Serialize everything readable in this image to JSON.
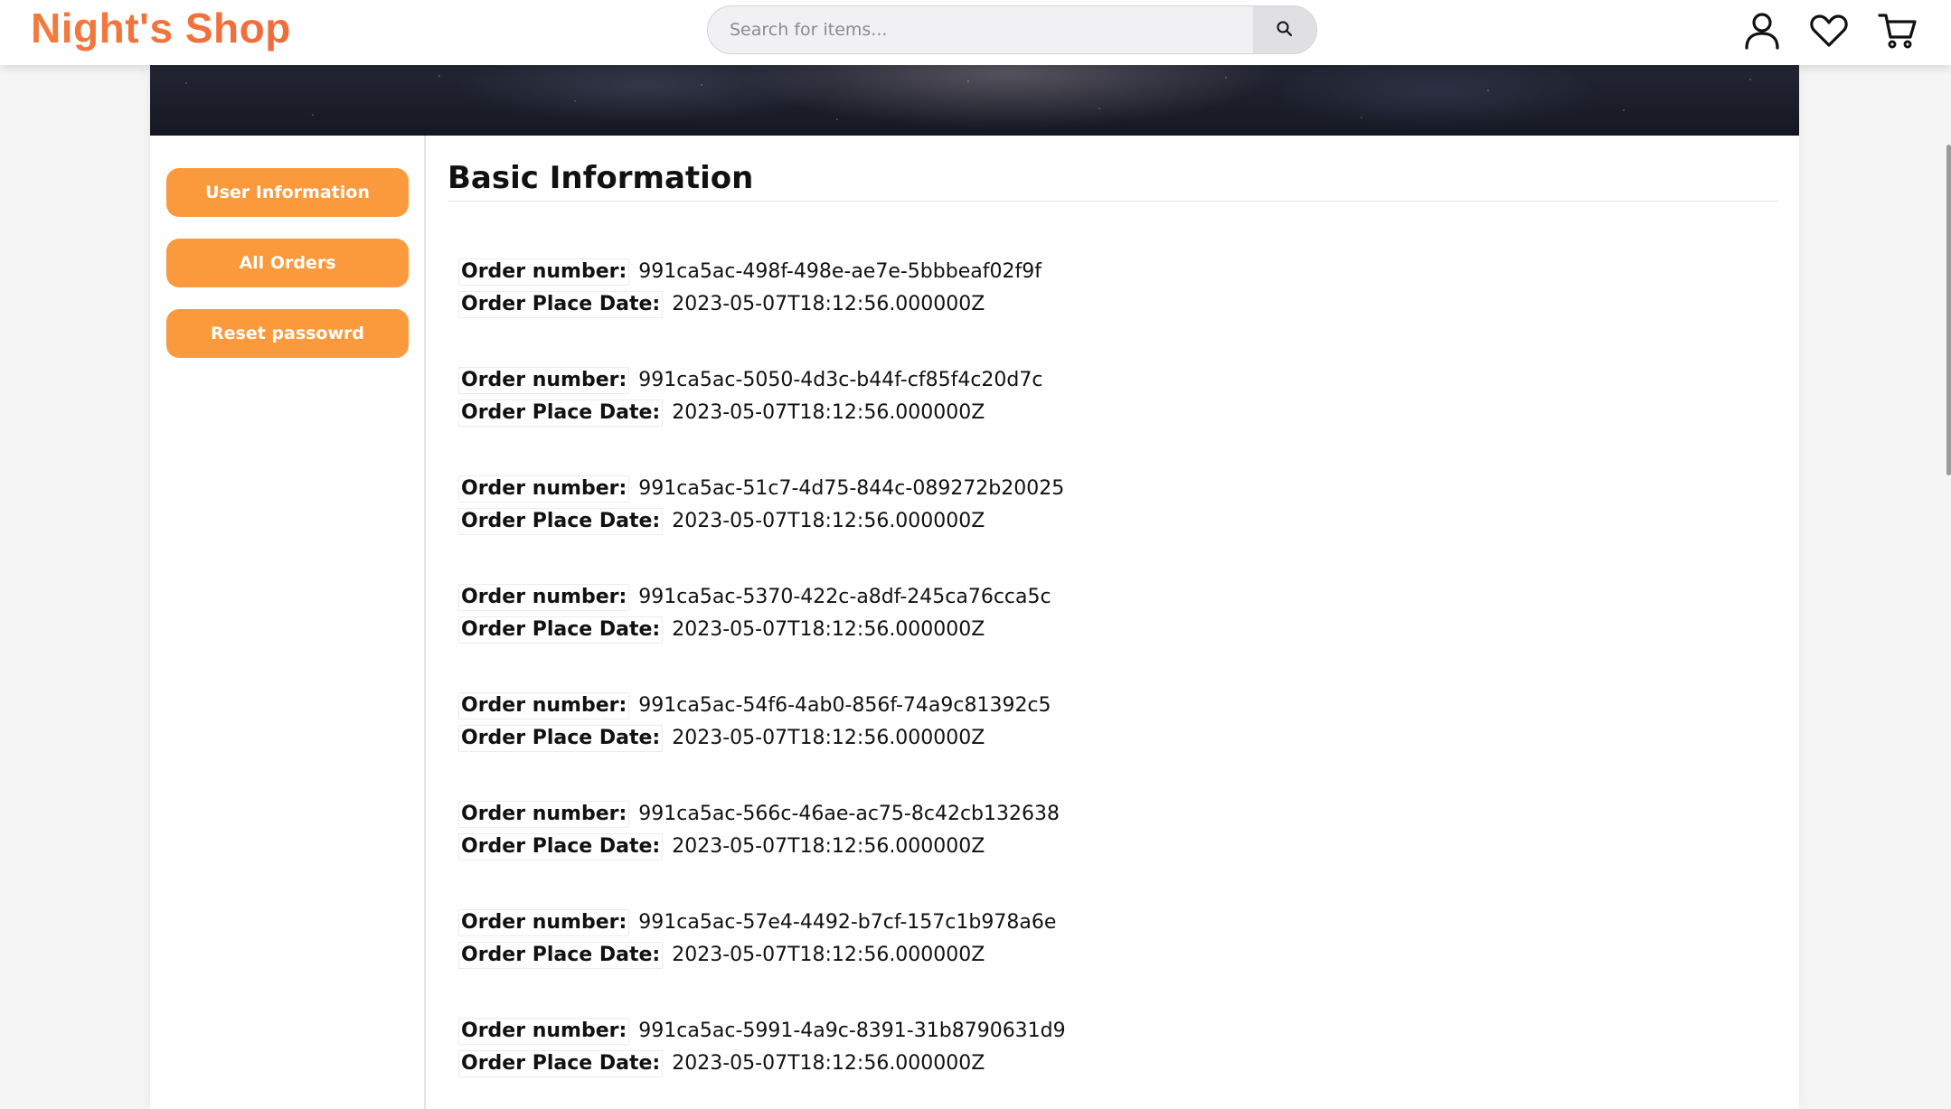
{
  "header": {
    "logo": "Night's Shop",
    "search_placeholder": "Search for items...",
    "icons": [
      "user-icon",
      "heart-icon",
      "cart-icon"
    ]
  },
  "sidebar": {
    "buttons": [
      "User Information",
      "All Orders",
      "Reset passowrd"
    ]
  },
  "main": {
    "title": "Basic Information",
    "order_number_label": "Order number:",
    "order_date_label": "Order Place Date:",
    "orders": [
      {
        "number": "991ca5ac-498f-498e-ae7e-5bbbeaf02f9f",
        "date": "2023-05-07T18:12:56.000000Z"
      },
      {
        "number": "991ca5ac-5050-4d3c-b44f-cf85f4c20d7c",
        "date": "2023-05-07T18:12:56.000000Z"
      },
      {
        "number": "991ca5ac-51c7-4d75-844c-089272b20025",
        "date": "2023-05-07T18:12:56.000000Z"
      },
      {
        "number": "991ca5ac-5370-422c-a8df-245ca76cca5c",
        "date": "2023-05-07T18:12:56.000000Z"
      },
      {
        "number": "991ca5ac-54f6-4ab0-856f-74a9c81392c5",
        "date": "2023-05-07T18:12:56.000000Z"
      },
      {
        "number": "991ca5ac-566c-46ae-ac75-8c42cb132638",
        "date": "2023-05-07T18:12:56.000000Z"
      },
      {
        "number": "991ca5ac-57e4-4492-b7cf-157c1b978a6e",
        "date": "2023-05-07T18:12:56.000000Z"
      },
      {
        "number": "991ca5ac-5991-4a9c-8391-31b8790631d9",
        "date": "2023-05-07T18:12:56.000000Z"
      }
    ]
  },
  "colors": {
    "accent": "#fb9a3c",
    "logo": "#f47a3c"
  }
}
